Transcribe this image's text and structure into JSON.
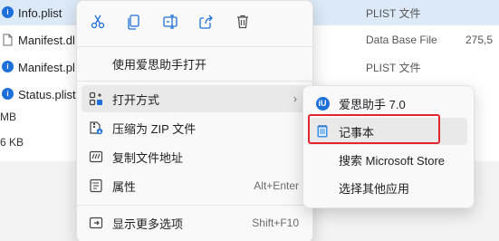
{
  "files": [
    {
      "name": "Info.plist",
      "mid": "0",
      "type": "PLIST 文件",
      "size": "",
      "selected": true
    },
    {
      "name": "Manifest.dl",
      "mid": "",
      "type": "Data Base File",
      "size": "275,5",
      "selected": false
    },
    {
      "name": "Manifest.pl",
      "mid": "",
      "type": "PLIST 文件",
      "size": "",
      "selected": false
    },
    {
      "name": "Status.plist",
      "mid": "",
      "type": "",
      "size": "",
      "selected": false
    }
  ],
  "partial_rows": [
    "MB",
    "6 KB"
  ],
  "quick_actions": [
    {
      "name": "cut-icon",
      "label": "剪切"
    },
    {
      "name": "copy-icon",
      "label": "复制"
    },
    {
      "name": "rename-icon",
      "label": "重命名"
    },
    {
      "name": "share-icon",
      "label": "共享"
    },
    {
      "name": "delete-icon",
      "label": "删除"
    }
  ],
  "menu": {
    "open_with_i4": "使用爱思助手打开",
    "open_with": "打开方式",
    "compress_zip": "压缩为 ZIP 文件",
    "copy_path": "复制文件地址",
    "properties": "属性",
    "properties_shortcut": "Alt+Enter",
    "more_options": "显示更多选项",
    "more_options_shortcut": "Shift+F10",
    "arrow": "›"
  },
  "submenu": {
    "items": [
      {
        "label": "爱思助手 7.0",
        "icon": "i4-app-icon"
      },
      {
        "label": "记事本",
        "icon": "notepad-icon"
      },
      {
        "label": "搜索 Microsoft Store",
        "icon": ""
      },
      {
        "label": "选择其他应用",
        "icon": ""
      }
    ]
  },
  "colors": {
    "accent": "#1e6fd9",
    "highlight": "#e3262d",
    "selection": "#dce9f7"
  }
}
